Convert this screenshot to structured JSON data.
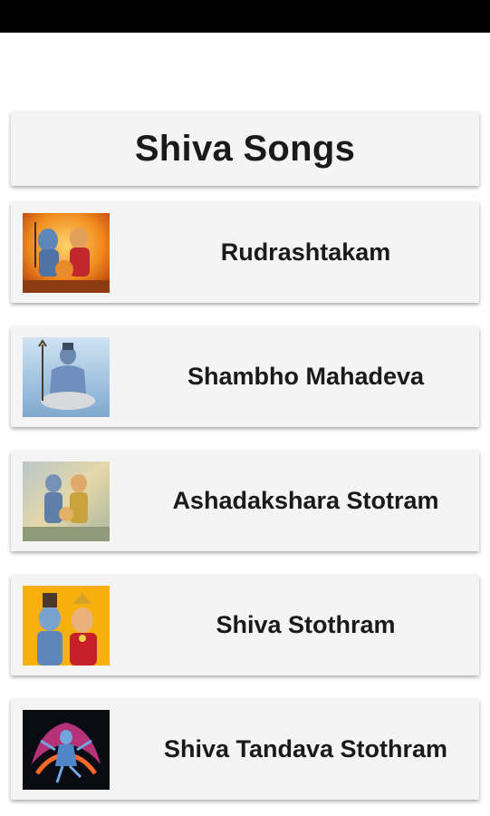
{
  "header": {
    "title": "Shiva Songs"
  },
  "songs": [
    {
      "label": "Rudrashtakam",
      "icon": "shiva-family-thumbnail"
    },
    {
      "label": "Shambho Mahadeva",
      "icon": "shiva-meditating-thumbnail"
    },
    {
      "label": "Ashadakshara Stotram",
      "icon": "shiva-parvati-thumbnail"
    },
    {
      "label": "Shiva Stothram",
      "icon": "shiva-parvati-portrait-thumbnail"
    },
    {
      "label": "Shiva Tandava Stothram",
      "icon": "shiva-tandava-thumbnail"
    }
  ],
  "colors": {
    "status_bar": "#000000",
    "card_bg": "#f4f4f4",
    "text": "#1a1a1a"
  }
}
